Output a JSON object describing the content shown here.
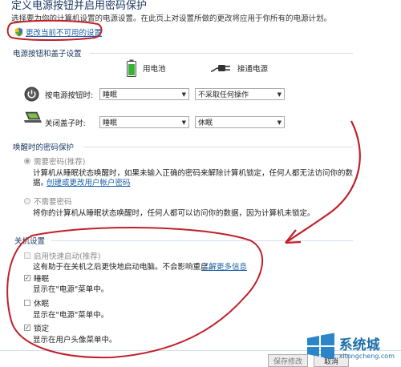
{
  "header": {
    "title": "定义电源按钮并启用密码保护",
    "description": "选择要为你的计算机设置的电源设置。在此页上对设置所做的更改将应用于你所有的电源计划。",
    "change_settings_link": "更改当前不可用的设置"
  },
  "power_buttons": {
    "section_title": "电源按钮和盖子设置",
    "col_battery": "用电池",
    "col_plugged": "接通电源",
    "rows": [
      {
        "label": "按电源按钮时:",
        "battery": "睡眠",
        "plugged": "不采取任何操作"
      },
      {
        "label": "关闭盖子时:",
        "battery": "睡眠",
        "plugged": "休眠"
      }
    ]
  },
  "wake_password": {
    "section_title": "唤醒时的密码保护",
    "require": {
      "label": "需要密码(推荐)",
      "desc": "计算机从睡眠状态唤醒时，如果未输入正确的密码来解除计算机锁定，任何人都无法访问你的数",
      "desc2": "据。",
      "link": "创建或更改用户帐户密码"
    },
    "no_require": {
      "label": "不需要密码",
      "desc": "将你的计算机从睡眠状态唤醒时，任何人都可以访问你的数据，因为计算机未锁定。"
    }
  },
  "shutdown": {
    "section_title": "关机设置",
    "items": [
      {
        "label": "启用快速启动(推荐)",
        "checked": false,
        "desc": "这有助于在关机之后更快地启动电脑。不会影响重启。",
        "link": "了解更多信息"
      },
      {
        "label": "睡眠",
        "checked": true,
        "desc": "显示在\"电源\"菜单中。"
      },
      {
        "label": "休眠",
        "checked": false,
        "desc": "显示在\"电源\"菜单中。"
      },
      {
        "label": "锁定",
        "checked": true,
        "desc": "显示在用户头像菜单中。"
      }
    ]
  },
  "footer": {
    "save_button": "保存修改",
    "cancel_button": "取消"
  },
  "watermark": {
    "brand": "系统城",
    "url": "xitongcheng.com"
  },
  "colors": {
    "annotation_red": "#c0202a",
    "link_blue": "#1a5ea8",
    "title_blue": "#1e3a63"
  }
}
